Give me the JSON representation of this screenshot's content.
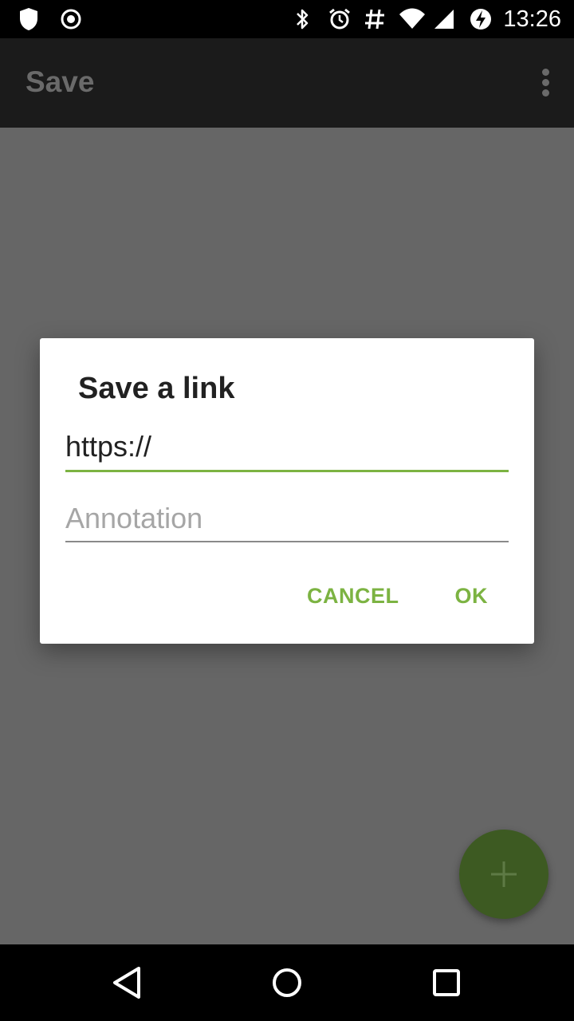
{
  "status_bar": {
    "time": "13:26",
    "icons": [
      "shield-icon",
      "record-icon",
      "bluetooth-icon",
      "alarm-icon",
      "hash-icon",
      "wifi-icon",
      "signal-icon",
      "battery-charging-icon"
    ]
  },
  "app_bar": {
    "title": "Save",
    "overflow_icon": "more-vert-icon"
  },
  "dialog": {
    "title": "Save a link",
    "url_field": {
      "value": "https://",
      "placeholder": ""
    },
    "annotation_field": {
      "value": "",
      "placeholder": "Annotation"
    },
    "cancel_label": "CANCEL",
    "ok_label": "OK"
  },
  "fab": {
    "icon": "plus-icon"
  },
  "nav_bar": {
    "icons": [
      "back-icon",
      "home-icon",
      "recents-icon"
    ]
  },
  "colors": {
    "accent": "#7cb342",
    "scrim": "#666666",
    "app_bar": "#1b1b1b",
    "fab_dimmed": "#3d5a22"
  }
}
